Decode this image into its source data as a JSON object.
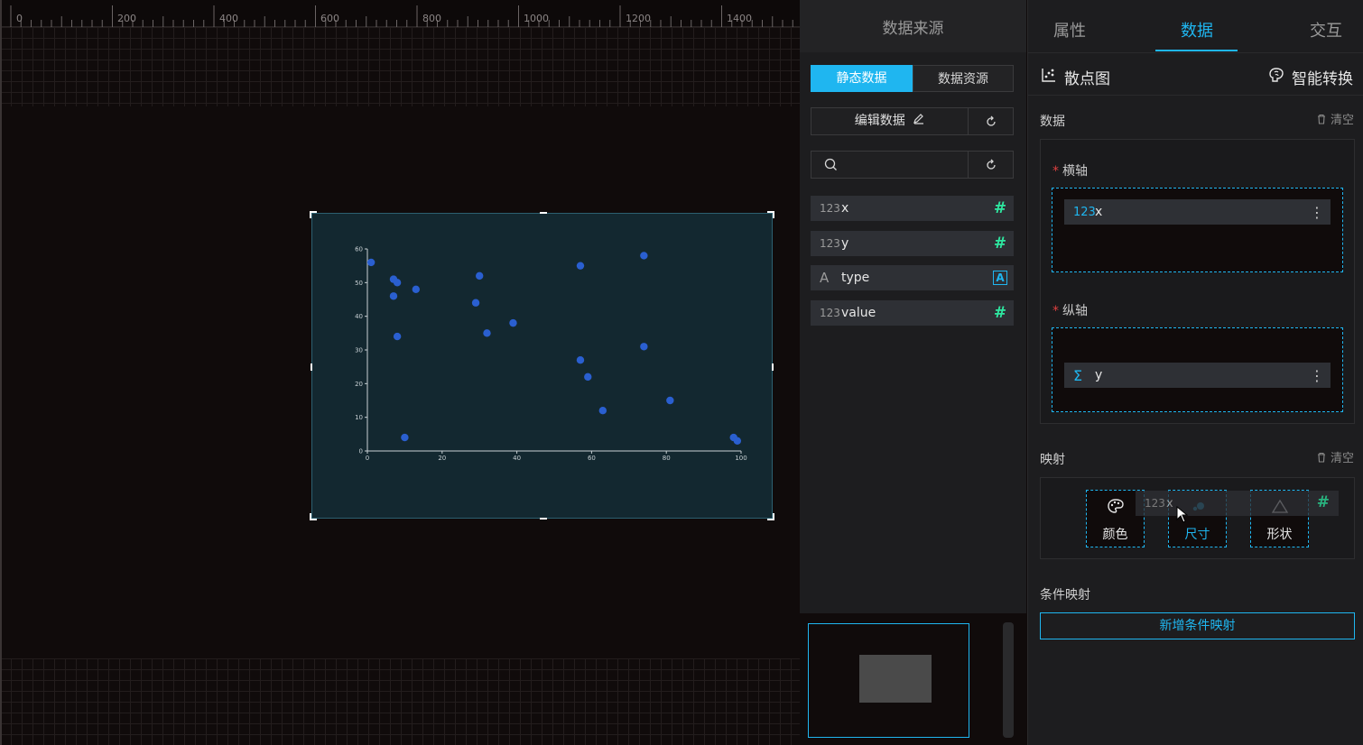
{
  "ruler": {
    "labels": [
      "0",
      "200",
      "400",
      "600",
      "800",
      "1000",
      "1200",
      "1400"
    ]
  },
  "chart_data": {
    "type": "scatter",
    "title": "",
    "xlabel": "",
    "ylabel": "",
    "xlim": [
      0,
      100
    ],
    "ylim": [
      0,
      60
    ],
    "xticks": [
      0,
      20,
      40,
      60,
      80,
      100
    ],
    "yticks": [
      0,
      10,
      20,
      30,
      40,
      50,
      60
    ],
    "grid": false,
    "color": "#2a5fd0",
    "points": [
      {
        "x": 1,
        "y": 56
      },
      {
        "x": 7,
        "y": 51
      },
      {
        "x": 8,
        "y": 50
      },
      {
        "x": 7,
        "y": 46
      },
      {
        "x": 13,
        "y": 48
      },
      {
        "x": 8,
        "y": 34
      },
      {
        "x": 10,
        "y": 4
      },
      {
        "x": 29,
        "y": 44
      },
      {
        "x": 30,
        "y": 52
      },
      {
        "x": 32,
        "y": 35
      },
      {
        "x": 39,
        "y": 38
      },
      {
        "x": 57,
        "y": 55
      },
      {
        "x": 57,
        "y": 27
      },
      {
        "x": 59,
        "y": 22
      },
      {
        "x": 63,
        "y": 12
      },
      {
        "x": 74,
        "y": 58
      },
      {
        "x": 74,
        "y": 31
      },
      {
        "x": 81,
        "y": 15
      },
      {
        "x": 98,
        "y": 4
      },
      {
        "x": 99,
        "y": 3
      }
    ]
  },
  "source_panel": {
    "title": "数据来源",
    "seg_static": "静态数据",
    "seg_resource": "数据资源",
    "edit_data": "编辑数据",
    "search_placeholder": "",
    "fields": [
      {
        "type_label": "123",
        "name": "x",
        "badge": "#"
      },
      {
        "type_label": "123",
        "name": "y",
        "badge": "#"
      },
      {
        "type_label": "A",
        "name": "type",
        "badge": "A"
      },
      {
        "type_label": "123",
        "name": "value",
        "badge": "#"
      }
    ]
  },
  "right_panel": {
    "tabs": [
      "属性",
      "数据",
      "交互"
    ],
    "active_tab": "数据",
    "chart_type": "散点图",
    "smart_convert": "智能转换",
    "data_section": "数据",
    "clear": "清空",
    "x_axis_label": "横轴",
    "x_axis_field": {
      "icon": "123",
      "name": "x"
    },
    "y_axis_label": "纵轴",
    "y_axis_field": {
      "icon": "Σ",
      "name": "y"
    },
    "mapping_section": "映射",
    "mapping_clear": "清空",
    "mapping_slots": [
      "颜色",
      "尺寸",
      "形状"
    ],
    "drag_ghost": {
      "type_label": "123",
      "name": "x",
      "badge": "#"
    },
    "conditional_section": "条件映射",
    "add_conditional": "新增条件映射"
  },
  "colors": {
    "accent": "#1fb6f0",
    "field_badge": "#2ee6a0",
    "point": "#2a5fd0",
    "chart_bg": "#132830"
  }
}
